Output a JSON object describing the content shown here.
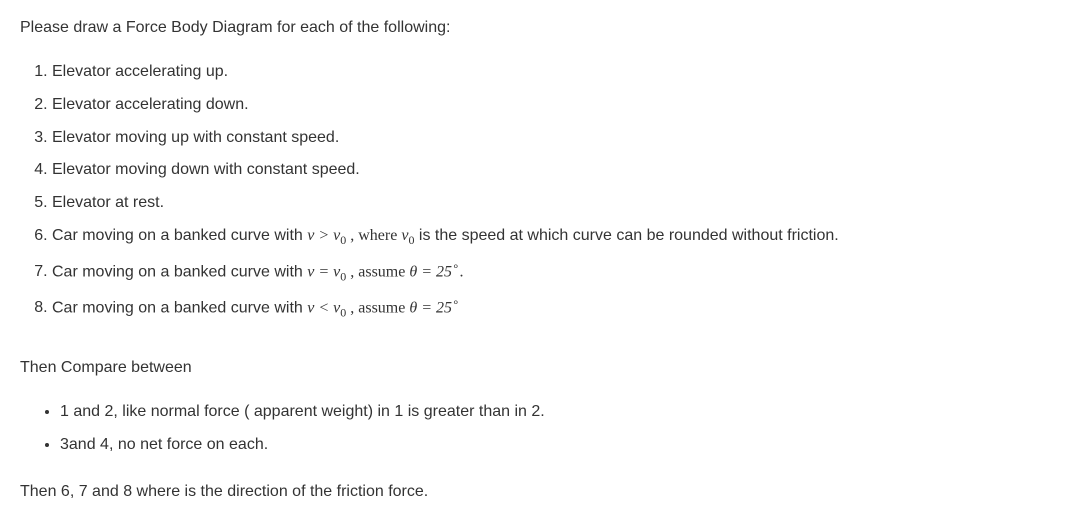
{
  "intro": "Please draw a Force Body Diagram for each of the following:",
  "items": {
    "i1": "Elevator accelerating up.",
    "i2": "Elevator accelerating down.",
    "i3": "Elevator moving up with constant speed.",
    "i4": "Elevator moving down with constant speed.",
    "i5": "Elevator at rest.",
    "i6_pre": "Car moving on a banked curve  with   ",
    "i6_math": "v > v",
    "i6_sub": "0",
    "i6_mid": " ,   where ",
    "i6_math2": "v",
    "i6_sub2": "0",
    "i6_post": "  is the speed at which curve can be rounded without friction.",
    "i7_pre": "Car moving on a banked curve with ",
    "i7_math": "v = v",
    "i7_sub": "0",
    "i7_mid": " ,   assume ",
    "i7_theta": "θ = 25",
    "i7_deg": "∘",
    "i7_end": ".",
    "i8_pre": "Car moving on a banked curve with ",
    "i8_math": "v < v",
    "i8_sub": "0",
    "i8_mid": " ,   assume ",
    "i8_theta": "θ = 25",
    "i8_deg": "∘"
  },
  "compare_heading": "Then Compare between",
  "compare": {
    "c1": "1 and 2, like normal force ( apparent weight)  in 1 is greater than in 2.",
    "c2": "3and 4, no net force on each."
  },
  "final": "Then 6, 7 and 8 where is the direction of the friction force."
}
